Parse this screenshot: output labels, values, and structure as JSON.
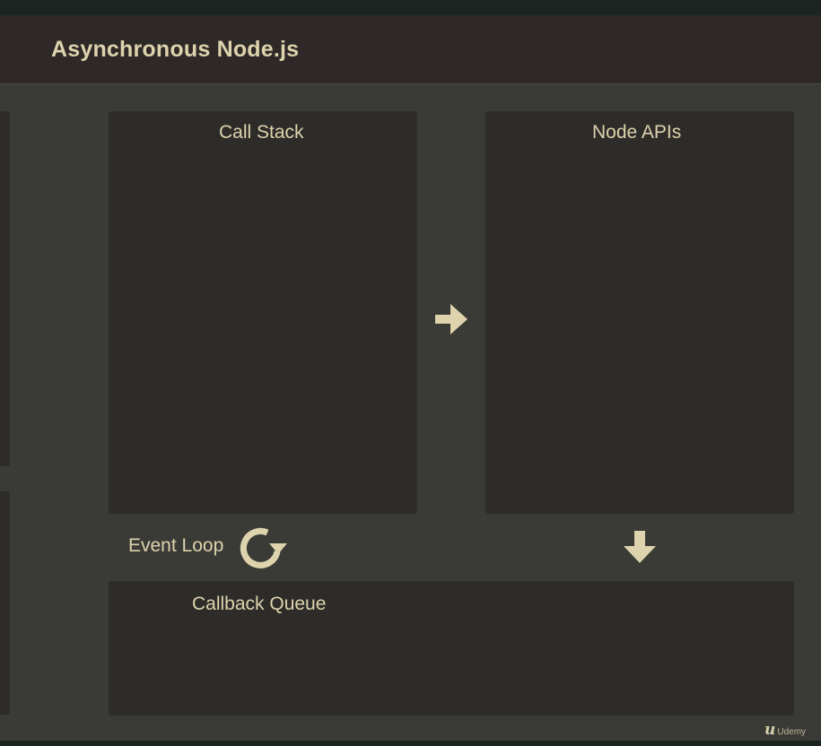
{
  "header": {
    "title": "Asynchronous Node.js"
  },
  "diagram": {
    "call_stack": {
      "label": "Call Stack"
    },
    "node_apis": {
      "label": "Node APIs"
    },
    "callback_queue": {
      "label": "Callback Queue"
    },
    "event_loop": {
      "label": "Event Loop"
    }
  },
  "icons": {
    "arrow_right": "arrow-right-icon",
    "arrow_down": "arrow-down-icon",
    "loop": "refresh-icon"
  },
  "watermark": {
    "brand": "Udemy",
    "logo_letter": "u"
  },
  "colors": {
    "accent": "#ddd3ad",
    "background": "#3a3a36",
    "panel": "#2d2c29",
    "header": "#2e2927",
    "top_strip": "#1b2421"
  }
}
